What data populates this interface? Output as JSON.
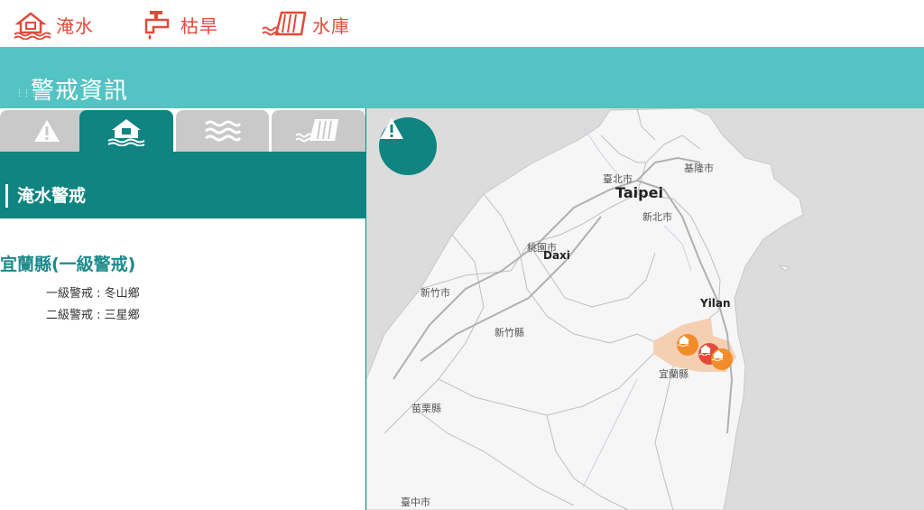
{
  "nav": [
    {
      "label": "淹水",
      "icon": "flood-house-icon"
    },
    {
      "label": "枯旱",
      "icon": "faucet-drought-icon"
    },
    {
      "label": "水庫",
      "icon": "reservoir-dam-icon"
    }
  ],
  "banner": {
    "title": "警戒資訊"
  },
  "tabs": [
    {
      "icon": "warning-icon",
      "active": false
    },
    {
      "icon": "flood-house-icon",
      "active": true
    },
    {
      "icon": "waves-icon",
      "active": false
    },
    {
      "icon": "reservoir-dam-icon",
      "active": false
    }
  ],
  "section": {
    "title": "淹水警戒"
  },
  "alerts": {
    "county": "宜蘭縣(一級警戒)",
    "lines": [
      "一級警戒 : 冬山鄉",
      "二級警戒 : 三星鄉"
    ]
  },
  "map": {
    "labels": {
      "taipei_zh": "臺北市",
      "taipei_en": "Taipei",
      "keelung": "基隆市",
      "newtaipei": "新北市",
      "taoyuan": "桃園市",
      "daxi": "Daxi",
      "hsinchu_city": "新竹市",
      "hsinchu_county": "新竹縣",
      "yilan_en": "Yilan",
      "yilan_zh": "宜蘭縣",
      "miaoli": "苗栗縣",
      "taichung": "臺中市"
    },
    "marker_colors": {
      "level1": "#e24b3c",
      "level2": "#f08c2a"
    }
  },
  "colors": {
    "accent_red": "#e24b3c",
    "teal_light": "#53c3c3",
    "teal_dark": "#0f8480",
    "tab_grey": "#c9c9c9"
  }
}
